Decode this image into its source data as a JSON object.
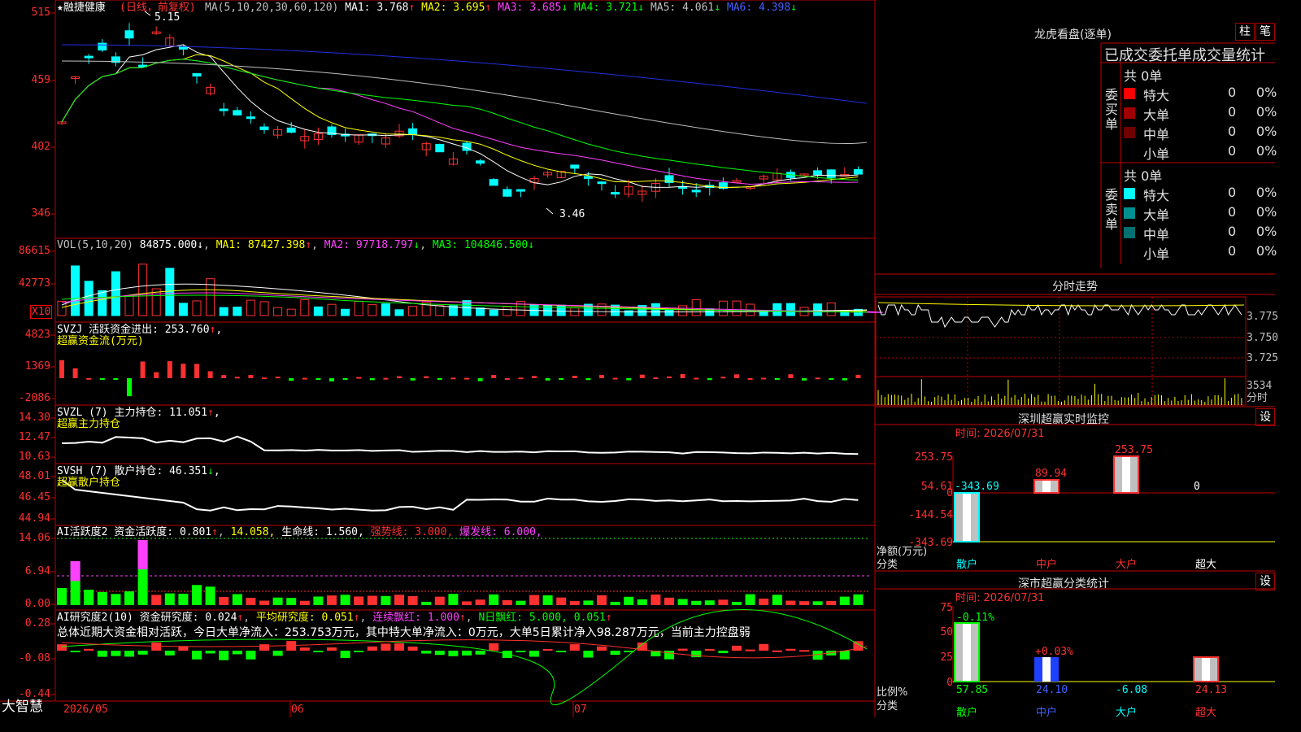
{
  "app": {
    "brand": "大智慧"
  },
  "stock": {
    "name": "★融捷健康",
    "period": "(日线，前复权)"
  },
  "main_panel": {
    "y_ticks": [
      "515",
      "459",
      "402",
      "346"
    ],
    "ma_prefix": "MA(5,10,20,30,60,120)",
    "ma": [
      {
        "label": "MA1:",
        "value": "3.768",
        "arrow": "↑",
        "color": "#ffffff"
      },
      {
        "label": "MA2:",
        "value": "3.695",
        "arrow": "↑",
        "color": "#ffff00"
      },
      {
        "label": "MA3:",
        "value": "3.685",
        "arrow": "↓",
        "color": "#ff40ff"
      },
      {
        "label": "MA4:",
        "value": "3.721",
        "arrow": "↓",
        "color": "#00ff00"
      },
      {
        "label": "MA5:",
        "value": "4.061",
        "arrow": "↓",
        "color": "#c0c0c0"
      },
      {
        "label": "MA6:",
        "value": "4.398",
        "arrow": "↓",
        "color": "#4060ff"
      }
    ],
    "high_label": "5.15",
    "low_label": "3.46"
  },
  "vol_panel": {
    "y_ticks": [
      "86615",
      "42773"
    ],
    "unit": "X10",
    "prefix": "VOL(5,10,20)",
    "value": "84875.000",
    "ma1": "87427.398",
    "ma2": "97718.797",
    "ma3": "104846.500"
  },
  "svzj_panel": {
    "y_ticks": [
      "4823",
      "1369",
      "-2086"
    ],
    "line1": "SVZJ  活跃资金进出: 253.760",
    "line2": "超赢资金流(万元)"
  },
  "svzl_panel": {
    "y_ticks": [
      "14.30",
      "12.47",
      "10.63"
    ],
    "line1": "SVZL (7) 主力持仓: 11.051",
    "line2": "超赢主力持仓"
  },
  "svsh_panel": {
    "y_ticks": [
      "48.01",
      "46.45",
      "44.94"
    ],
    "line1": "SVSH (7) 散户持仓: 46.351",
    "line2": "超赢散户持仓"
  },
  "ai_active_panel": {
    "y_ticks": [
      "14.06",
      "6.94",
      "0.00"
    ],
    "title": "AI活跃度2 资金活跃度: 0.801",
    "v2": "14.058",
    "v3": "生命线: 1.560,",
    "v4": "强势线: 3.000,",
    "v5": "爆发线: 6.000,"
  },
  "ai_research_panel": {
    "y_ticks": [
      "0.28",
      "-0.08",
      "-0.44"
    ],
    "title": "AI研究度2(10) 资金研究度: 0.024",
    "avg": "平均研究度: 0.051",
    "chain": "连续飘红: 1.000",
    "nday": "N日飘红: 5.000, 0.051",
    "summary": "总体近期大资金相对活跃，今日大单净流入：253.753万元，其中特大单净流入：0万元，大单5日累计净入98.287万元，当前主力控盘弱"
  },
  "x_axis": {
    "labels": [
      "2026/05",
      "06",
      "07"
    ]
  },
  "dragon_tiger": {
    "title": "龙虎看盘(逐单)",
    "btn_bar": "柱",
    "btn_pen": "笔",
    "header": "已成交委托单成交量统计",
    "buy": {
      "side_label": "委买单",
      "total": "共 0单",
      "rows": [
        {
          "label": "特大",
          "count": "0",
          "pct": "0%",
          "color": "#ff0000"
        },
        {
          "label": "大单",
          "count": "0",
          "pct": "0%",
          "color": "#a00000"
        },
        {
          "label": "中单",
          "count": "0",
          "pct": "0%",
          "color": "#700000"
        },
        {
          "label": "小单",
          "count": "0",
          "pct": "0%",
          "color": "#000000"
        }
      ]
    },
    "sell": {
      "side_label": "委卖单",
      "total": "共 0单",
      "rows": [
        {
          "label": "特大",
          "count": "0",
          "pct": "0%",
          "color": "#00ffff"
        },
        {
          "label": "大单",
          "count": "0",
          "pct": "0%",
          "color": "#009090"
        },
        {
          "label": "中单",
          "count": "0",
          "pct": "0%",
          "color": "#007070"
        },
        {
          "label": "小单",
          "count": "0",
          "pct": "0%",
          "color": "#000000"
        }
      ]
    }
  },
  "intraday": {
    "title": "分时走势",
    "y_ticks": [
      "3.775",
      "3.750",
      "3.725"
    ],
    "vol_tick": "3534",
    "vol_unit": "分时"
  },
  "sz_monitor": {
    "title": "深圳超赢实时监控",
    "btn": "设",
    "time": "时间: 2026/07/31",
    "y_ticks": [
      "253.75",
      "54.61",
      "0",
      "-144.54",
      "-343.69"
    ],
    "bar_labels": [
      "-343.69",
      "89.94",
      "253.75",
      "0"
    ],
    "ylabel": "净额(万元)",
    "xlabel": "分类",
    "categories": [
      "散户",
      "中户",
      "大户",
      "超大"
    ]
  },
  "sz_class": {
    "title": "深市超赢分类统计",
    "btn": "设",
    "time": "时间: 2026/07/31",
    "y_ticks": [
      "75",
      "50",
      "25",
      "0"
    ],
    "bar_top": [
      "-0.11%",
      "+0.03%"
    ],
    "bottom_values": [
      "57.85",
      "24.10",
      "-6.08",
      "24.13"
    ],
    "ylabel": "比例%",
    "xlabel": "分类",
    "categories": [
      "散户",
      "中户",
      "大户",
      "超大"
    ]
  },
  "colors": {
    "grid": "#c00000",
    "up": "#ff3030",
    "down": "#00ffff",
    "bg": "#000000"
  }
}
